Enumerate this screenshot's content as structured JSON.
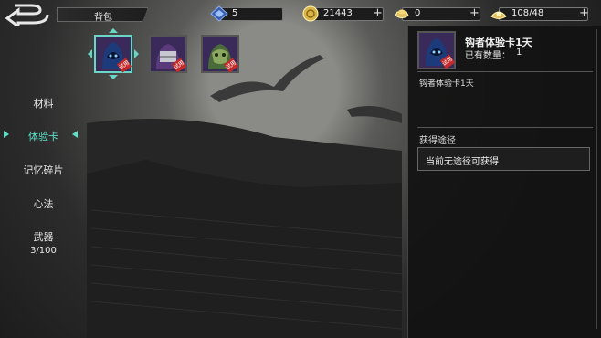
{
  "header": {
    "title": "背包"
  },
  "resources": [
    {
      "icon": "blue-gem-icon",
      "value": "5",
      "has_plus": false
    },
    {
      "icon": "gold-coin-icon",
      "value": "21443",
      "has_plus": true
    },
    {
      "icon": "ingot-icon",
      "value": "0",
      "has_plus": true
    },
    {
      "icon": "stamina-icon",
      "value": "108/48",
      "has_plus": true
    }
  ],
  "nav": {
    "items": [
      {
        "label": "材料",
        "sub": ""
      },
      {
        "label": "体验卡",
        "sub": "",
        "active": true
      },
      {
        "label": "记忆碎片",
        "sub": ""
      },
      {
        "label": "心法",
        "sub": ""
      },
      {
        "label": "武器",
        "sub": "3/100"
      }
    ]
  },
  "grid": {
    "items": [
      {
        "icon": "blue-hooded-hero-icon",
        "tag": "试用",
        "selected": true
      },
      {
        "icon": "purple-masked-hero-icon",
        "tag": "试用",
        "selected": false
      },
      {
        "icon": "green-masked-hero-icon",
        "tag": "试用",
        "selected": false
      }
    ]
  },
  "detail": {
    "name": "钩者体验卡1天",
    "owned_label": "已有数量：",
    "owned_value": "1",
    "description": "钩者体验卡1天",
    "source_title": "获得途径",
    "source_text": "当前无途径可获得",
    "tag": "试用"
  },
  "colors": {
    "accent": "#5fe0c8",
    "tag_red": "#c42a2a"
  }
}
